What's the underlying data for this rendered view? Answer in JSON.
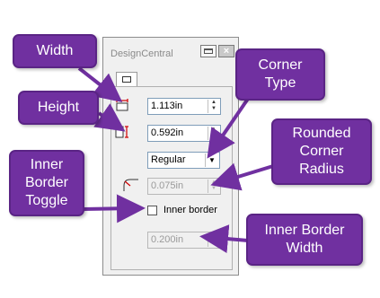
{
  "panel": {
    "title": "DesignCentral",
    "close_glyph": "×",
    "restore_icon": "window-restore-icon",
    "tab_icon": "rectangle-icon"
  },
  "fields": {
    "width": {
      "value": "1.113in",
      "icon": "width-dimension-icon"
    },
    "height": {
      "value": "0.592in",
      "icon": "height-dimension-icon"
    },
    "corner_type": {
      "selected": "Regular"
    },
    "corner_radius": {
      "value": "0.075in",
      "icon": "corner-radius-icon",
      "disabled": true
    },
    "inner_border": {
      "label": "Inner border",
      "checked": false
    },
    "inner_border_width": {
      "value": "0.200in",
      "disabled": true
    }
  },
  "callouts": {
    "width": "Width",
    "height": "Height",
    "inner_border_toggle": "Inner Border Toggle",
    "corner_type": "Corner Type",
    "rounded_corner_radius": "Rounded Corner Radius",
    "inner_border_width": "Inner Border Width"
  },
  "colors": {
    "callout_fill": "#7030a0",
    "callout_border": "#5a2485",
    "field_border": "#7f9db9",
    "disabled_text": "#9a9a9a"
  }
}
